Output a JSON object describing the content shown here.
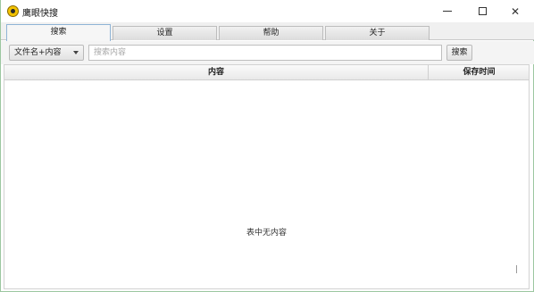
{
  "window": {
    "title": "鹰眼快搜",
    "icon": "eagle-eye-app-icon"
  },
  "tabs": [
    {
      "label": "搜索",
      "active": true
    },
    {
      "label": "设置",
      "active": false
    },
    {
      "label": "帮助",
      "active": false
    },
    {
      "label": "关于",
      "active": false
    }
  ],
  "search": {
    "scope_selected": "文件名+内容",
    "placeholder": "搜索内容",
    "value": "",
    "button_label": "搜索"
  },
  "table": {
    "columns": [
      "内容",
      "保存时间"
    ],
    "rows": [],
    "empty_text": "表中无内容"
  }
}
